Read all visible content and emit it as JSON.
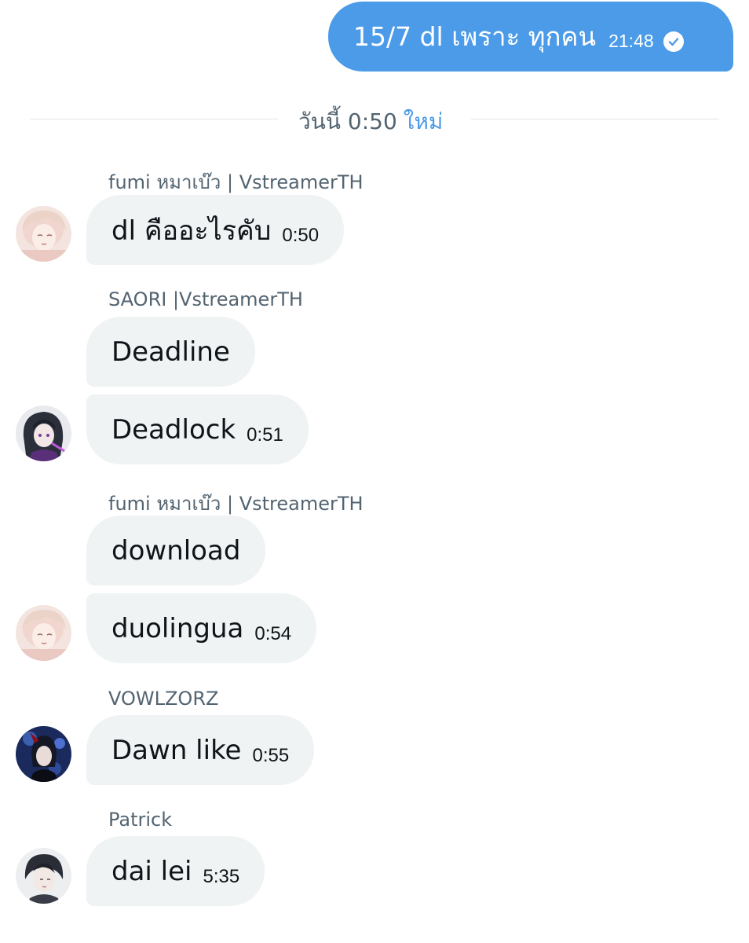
{
  "outgoing": {
    "text": "15/7 dl เพราะ ทุกคน",
    "time": "21:48"
  },
  "divider": {
    "label": "วันนี้ 0:50",
    "new_label": "ใหม่"
  },
  "messages": [
    {
      "sender": "fumi หมาเบ๊ว | VstreamerTH",
      "text": "dl คืออะไรคับ",
      "time": "0:50"
    },
    {
      "sender": "SAORI |VstreamerTH",
      "text": "Deadline",
      "time": ""
    },
    {
      "sender": "",
      "text": "Deadlock",
      "time": "0:51"
    },
    {
      "sender": "fumi หมาเบ๊ว | VstreamerTH",
      "text": "download",
      "time": ""
    },
    {
      "sender": "",
      "text": "duolingua",
      "time": "0:54"
    },
    {
      "sender": "VOWLZORZ",
      "text": "Dawn like",
      "time": "0:55"
    },
    {
      "sender": "Patrick",
      "text": "dai lei",
      "time": "5:35"
    }
  ],
  "colors": {
    "outgoing_bubble": "#4c9be8",
    "incoming_bubble": "#eff3f4",
    "secondary_text": "#536471",
    "accent": "#4c9be8"
  }
}
